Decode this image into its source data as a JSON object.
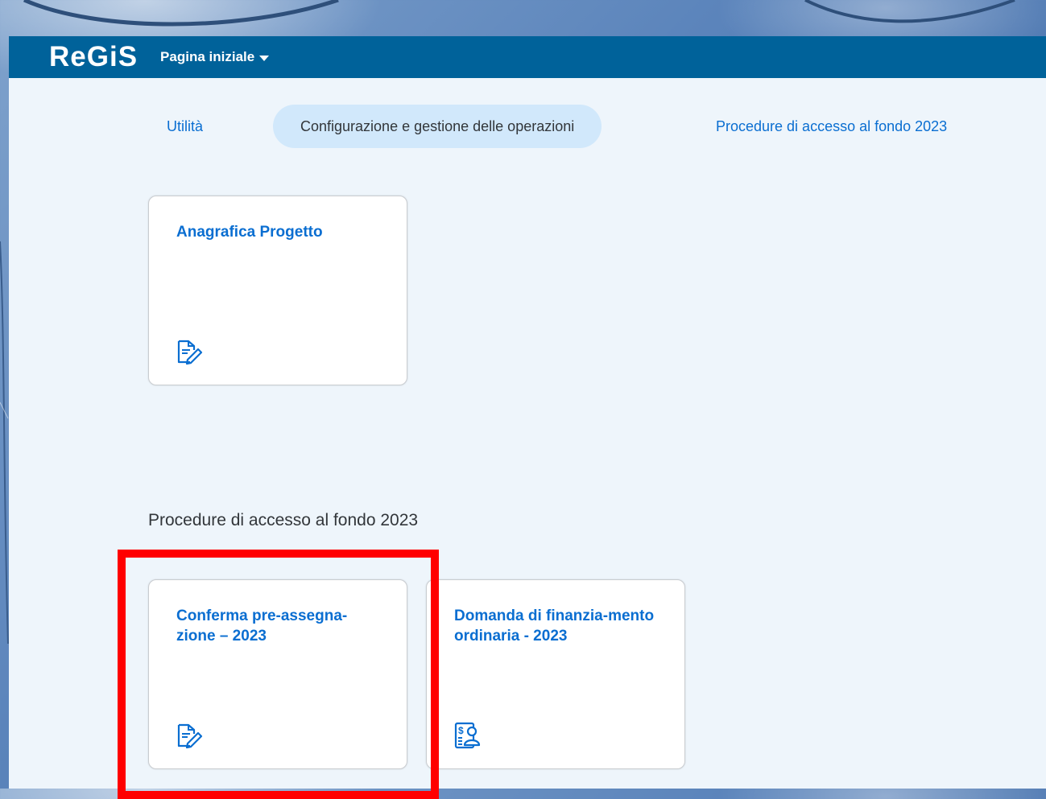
{
  "app": {
    "logo_text": "ReGiS",
    "page_menu_label": "Pagina iniziale"
  },
  "tabs": [
    {
      "label": "Utilità",
      "active": false
    },
    {
      "label": "Configurazione e gestione delle operazioni",
      "active": true
    },
    {
      "label": "Procedure di accesso al fondo 2023",
      "active": false
    }
  ],
  "sections": {
    "operations": {
      "tiles": [
        {
          "title": "Anagrafica Progetto",
          "icon": "document-edit-icon"
        }
      ]
    },
    "fund_access": {
      "title": "Procedure di accesso al fondo 2023",
      "tiles": [
        {
          "title": "Conferma pre-assegna-zione – 2023",
          "icon": "document-edit-icon",
          "highlighted": true
        },
        {
          "title": "Domanda di finanzia-mento ordinaria - 2023",
          "icon": "finance-request-icon",
          "highlighted": false
        }
      ]
    }
  },
  "colors": {
    "shellbar": "#00629a",
    "accent": "#0a6ed1",
    "highlight": "#ff0000",
    "active_tab": "#d1e8fb"
  }
}
